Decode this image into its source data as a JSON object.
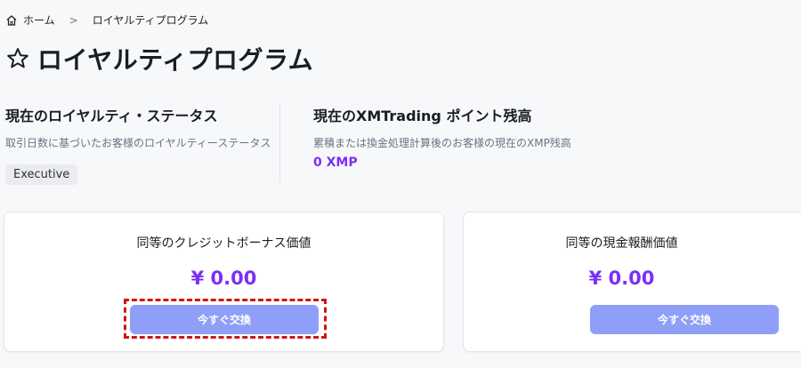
{
  "breadcrumb": {
    "home_label": "ホーム",
    "separator": ">",
    "current": "ロイヤルティプログラム"
  },
  "page": {
    "title": "ロイヤルティプログラム"
  },
  "loyalty_status": {
    "title": "現在のロイヤルティ・ステータス",
    "description": "取引日数に基づいたお客様のロイヤルティーステータス",
    "tier": "Executive"
  },
  "points_balance": {
    "title": "現在のXMTrading ポイント残高",
    "description": "累積または換金処理計算後のお客様の現在のXMP残高",
    "value": "0 XMP"
  },
  "cards": [
    {
      "title": "同等のクレジットボーナス価値",
      "value": "¥ 0.00",
      "button_label": "今すぐ交換"
    },
    {
      "title": "同等の現金報酬価値",
      "value": "¥ 0.00",
      "button_label": "今すぐ交換"
    }
  ],
  "colors": {
    "accent": "#7b2ff7",
    "button": "#8f9ff8",
    "highlight": "#d11414"
  },
  "icons": {
    "home": "home-icon",
    "title": "star-outline-icon"
  }
}
